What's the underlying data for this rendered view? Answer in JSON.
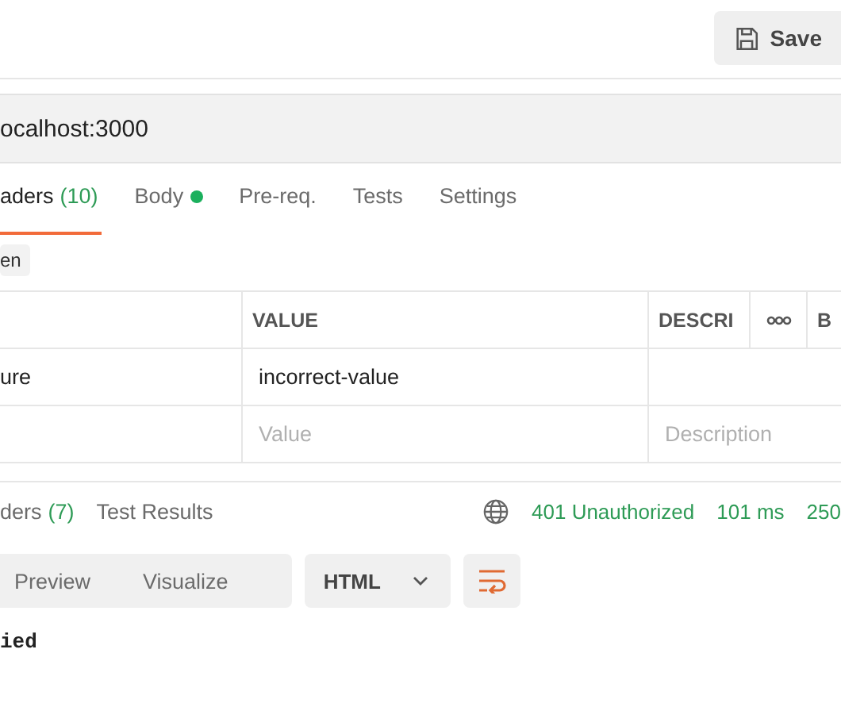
{
  "save_button": {
    "label": "Save"
  },
  "url": "ocalhost:3000",
  "request_tabs": [
    {
      "label": "aders",
      "count": "(10)",
      "selected": true,
      "dot": false
    },
    {
      "label": "Body",
      "selected": false,
      "dot": true
    },
    {
      "label": "Pre-req.",
      "selected": false,
      "dot": false
    },
    {
      "label": "Tests",
      "selected": false,
      "dot": false
    },
    {
      "label": "Settings",
      "selected": false,
      "dot": false
    }
  ],
  "chip": "en",
  "table": {
    "columns": [
      "VALUE",
      "DESCRI"
    ],
    "column_bulk": "B",
    "rows": [
      {
        "key": "ure",
        "value": "incorrect-value"
      },
      {
        "value_placeholder": "Value",
        "description_placeholder": "Description"
      }
    ]
  },
  "response_tabs": [
    {
      "label": "ders",
      "count": "(7)",
      "selected": false
    },
    {
      "label": "Test Results",
      "selected": false
    }
  ],
  "status": {
    "code": "401 Unauthorized",
    "time": "101 ms",
    "size": "250"
  },
  "view_modes": [
    {
      "label": "Preview",
      "selected": false
    },
    {
      "label": "Visualize",
      "selected": false
    }
  ],
  "format": "HTML",
  "body": "ied"
}
